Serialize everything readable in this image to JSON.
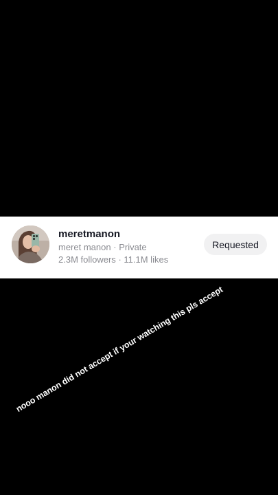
{
  "profile": {
    "username": "meretmanon",
    "display_name": "meret manon",
    "separator": "·",
    "privacy": "Private",
    "followers": "2.3M followers",
    "likes": "11.1M likes",
    "button_label": "Requested"
  },
  "overlay": {
    "caption": "nooo manon did not accept if your watching this pls accept"
  },
  "colors": {
    "background": "#000000",
    "card": "#ffffff",
    "button_bg": "#f1f1f2",
    "text_primary": "#161823",
    "text_secondary": "#8a8b91"
  },
  "icons": {
    "avatar": "profile-photo"
  }
}
